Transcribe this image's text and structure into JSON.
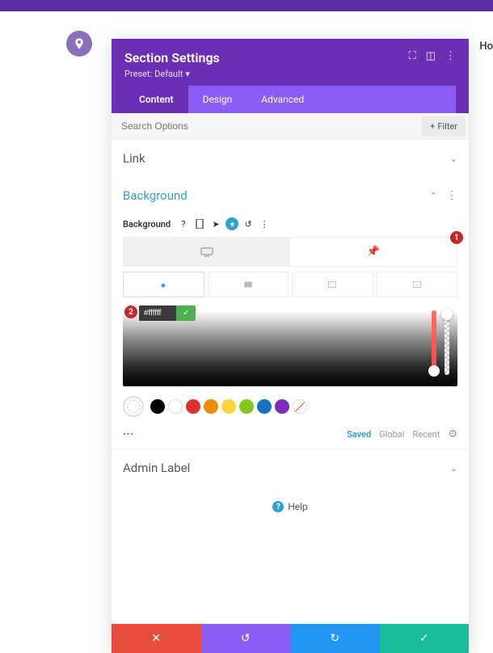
{
  "header_ho": "Ho",
  "modal": {
    "title": "Section Settings",
    "preset_label": "Preset:",
    "preset_value": "Default"
  },
  "tabs": {
    "content": "Content",
    "design": "Design",
    "advanced": "Advanced"
  },
  "search": {
    "placeholder": "Search Options"
  },
  "filter_label": "Filter",
  "sections": {
    "link": "Link",
    "background": "Background",
    "admin_label": "Admin Label"
  },
  "bg_label": "Background",
  "color_input": "#ffffff",
  "annotations": {
    "one": "1",
    "two": "2"
  },
  "saved_tabs": {
    "saved": "Saved",
    "global": "Global",
    "recent": "Recent"
  },
  "help": "Help",
  "swatches": [
    {
      "name": "current",
      "color": "#ffffff",
      "selected": true
    },
    {
      "name": "black",
      "color": "#000000"
    },
    {
      "name": "white",
      "color": "#ffffff"
    },
    {
      "name": "red",
      "color": "#e03131"
    },
    {
      "name": "orange",
      "color": "#f08c00"
    },
    {
      "name": "yellow",
      "color": "#ffd43b"
    },
    {
      "name": "lime",
      "color": "#82c91e"
    },
    {
      "name": "blue",
      "color": "#1971c2"
    },
    {
      "name": "purple",
      "color": "#7b2cbf"
    },
    {
      "name": "none",
      "color": "none"
    }
  ]
}
